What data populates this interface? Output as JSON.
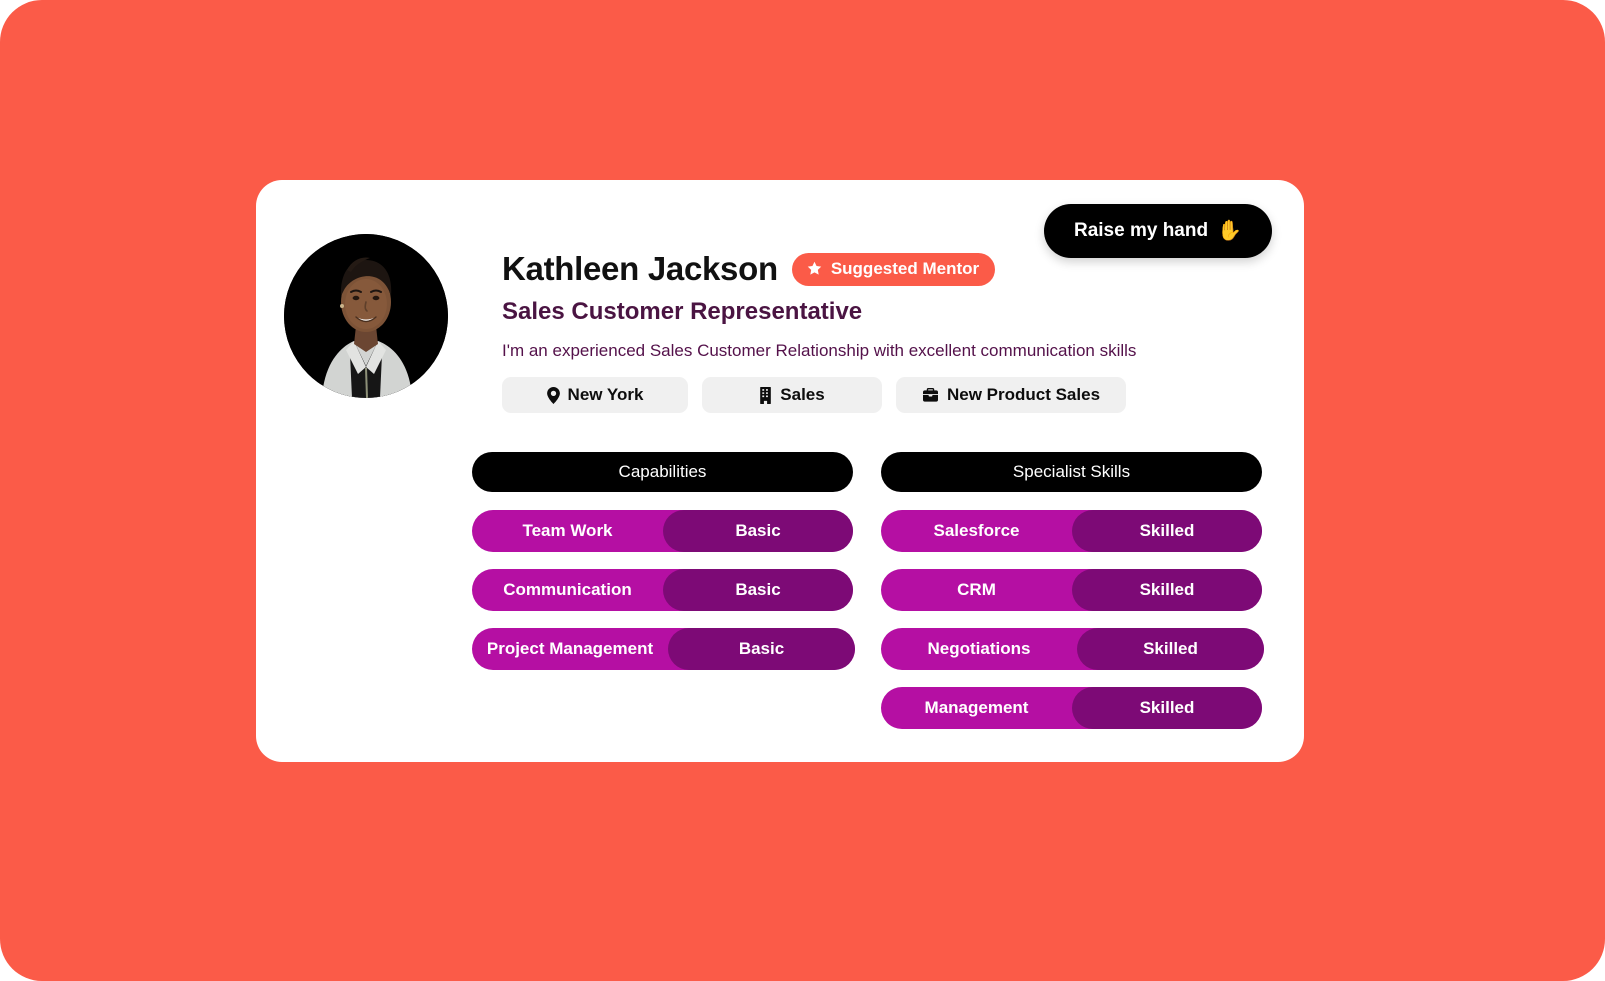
{
  "theme": {
    "background": "#fb5b48",
    "card_background": "#ffffff",
    "accent_coral": "#fb5b48",
    "skill_primary": "#b50fa3",
    "skill_level": "#7d0a76",
    "header_black": "#000000",
    "title_purple": "#4a1442"
  },
  "actions": {
    "raise_hand_label": "Raise my hand",
    "raise_hand_icon": "raised-hand-emoji"
  },
  "profile": {
    "avatar_alt": "Kathleen Jackson portrait",
    "name": "Kathleen Jackson",
    "badge": {
      "label": "Suggested Mentor",
      "icon": "star-icon"
    },
    "job_title": "Sales Customer Representative",
    "bio": "I'm an experienced Sales Customer Relationship with excellent communication skills",
    "tags": [
      {
        "label": "New York",
        "icon": "map-pin-icon"
      },
      {
        "label": "Sales",
        "icon": "building-icon"
      },
      {
        "label": "New Product Sales",
        "icon": "briefcase-icon"
      }
    ]
  },
  "skill_columns": [
    {
      "header": "Capabilities",
      "items": [
        {
          "name": "Team Work",
          "level": "Basic"
        },
        {
          "name": "Communication",
          "level": "Basic"
        },
        {
          "name": "Project Management",
          "level": "Basic"
        }
      ]
    },
    {
      "header": "Specialist Skills",
      "items": [
        {
          "name": "Salesforce",
          "level": "Skilled"
        },
        {
          "name": "CRM",
          "level": "Skilled"
        },
        {
          "name": "Negotiations",
          "level": "Skilled"
        },
        {
          "name": "Management",
          "level": "Skilled"
        }
      ]
    }
  ]
}
